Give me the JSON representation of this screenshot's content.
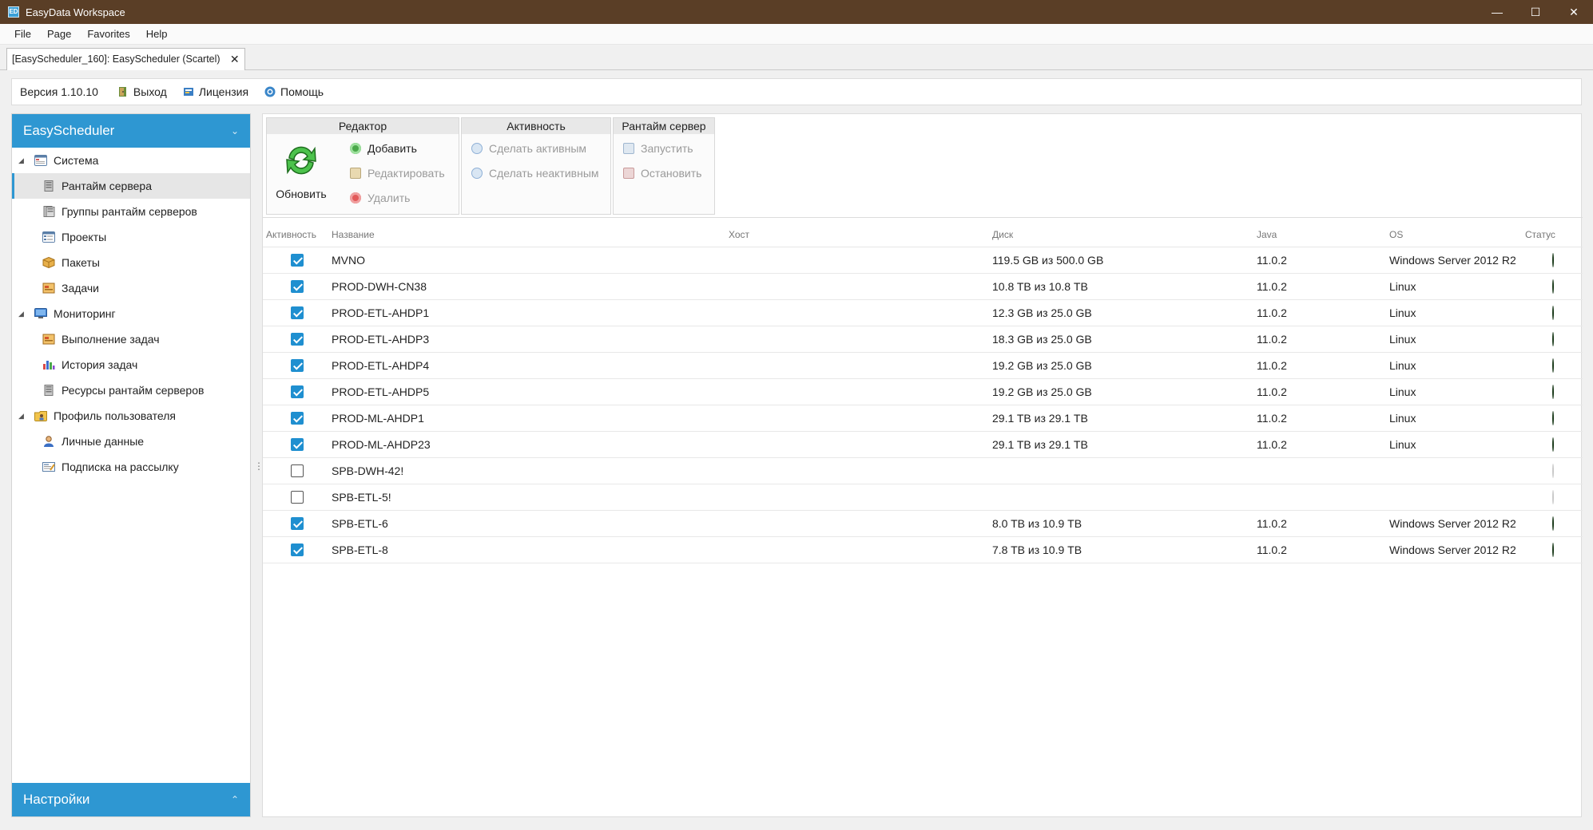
{
  "window": {
    "title": "EasyData Workspace",
    "icon_label": "ED",
    "controls": [
      "—",
      "☐",
      "✕"
    ]
  },
  "menu": [
    "File",
    "Page",
    "Favorites",
    "Help"
  ],
  "doc_tab": {
    "label": "[EasyScheduler_160]: EasyScheduler (Scartel)",
    "close": "✕"
  },
  "version_bar": {
    "version": "Версия 1.10.10",
    "exit": "Выход",
    "license": "Лицензия",
    "help": "Помощь"
  },
  "sidebar": {
    "header": "EasyScheduler",
    "footer": "Настройки",
    "items": [
      {
        "label": "Система",
        "icon": "window-icon"
      },
      {
        "label": "Рантайм сервера",
        "icon": "server-icon"
      },
      {
        "label": "Группы рантайм серверов",
        "icon": "server-group-icon"
      },
      {
        "label": "Проекты",
        "icon": "project-icon"
      },
      {
        "label": "Пакеты",
        "icon": "package-icon"
      },
      {
        "label": "Задачи",
        "icon": "task-icon"
      },
      {
        "label": "Мониторинг",
        "icon": "monitor-icon"
      },
      {
        "label": "Выполнение задач",
        "icon": "task-run-icon"
      },
      {
        "label": "История задач",
        "icon": "chart-icon"
      },
      {
        "label": "Ресурсы рантайм серверов",
        "icon": "server-resources-icon"
      },
      {
        "label": "Профиль пользователя",
        "icon": "profile-folder-icon"
      },
      {
        "label": "Личные данные",
        "icon": "user-icon"
      },
      {
        "label": "Подписка на рассылку",
        "icon": "subscription-icon"
      }
    ]
  },
  "ribbon": {
    "editor": {
      "title": "Редактор",
      "refresh": "Обновить",
      "add": "Добавить",
      "edit": "Редактировать",
      "delete": "Удалить"
    },
    "activity": {
      "title": "Активность",
      "make_active": "Сделать активным",
      "make_inactive": "Сделать неактивным"
    },
    "runtime": {
      "title": "Рантайм сервер",
      "start": "Запустить",
      "stop": "Остановить"
    }
  },
  "grid": {
    "headers": {
      "active": "Активность",
      "name": "Название",
      "host": "Хост",
      "disk": "Диск",
      "java": "Java",
      "os": "OS",
      "status": "Статус"
    },
    "rows": [
      {
        "active": true,
        "name": "MVNO",
        "host": "",
        "disk": "119.5 GB из 500.0 GB",
        "java": "11.0.2",
        "os": "Windows Server 2012 R2",
        "status": "online"
      },
      {
        "active": true,
        "name": "PROD-DWH-CN38",
        "host": "",
        "disk": "10.8 TB из 10.8 TB",
        "java": "11.0.2",
        "os": "Linux",
        "status": "online"
      },
      {
        "active": true,
        "name": "PROD-ETL-AHDP1",
        "host": "",
        "disk": "12.3 GB из 25.0 GB",
        "java": "11.0.2",
        "os": "Linux",
        "status": "online"
      },
      {
        "active": true,
        "name": "PROD-ETL-AHDP3",
        "host": "",
        "disk": "18.3 GB из 25.0 GB",
        "java": "11.0.2",
        "os": "Linux",
        "status": "online"
      },
      {
        "active": true,
        "name": "PROD-ETL-AHDP4",
        "host": "",
        "disk": "19.2 GB из 25.0 GB",
        "java": "11.0.2",
        "os": "Linux",
        "status": "online"
      },
      {
        "active": true,
        "name": "PROD-ETL-AHDP5",
        "host": "",
        "disk": "19.2 GB из 25.0 GB",
        "java": "11.0.2",
        "os": "Linux",
        "status": "online"
      },
      {
        "active": true,
        "name": "PROD-ML-AHDP1",
        "host": "",
        "disk": "29.1 TB из 29.1 TB",
        "java": "11.0.2",
        "os": "Linux",
        "status": "online"
      },
      {
        "active": true,
        "name": "PROD-ML-AHDP23",
        "host": "",
        "disk": "29.1 TB из 29.1 TB",
        "java": "11.0.2",
        "os": "Linux",
        "status": "online"
      },
      {
        "active": false,
        "name": "SPB-DWH-42!",
        "host": "",
        "disk": "",
        "java": "",
        "os": "",
        "status": "offline"
      },
      {
        "active": false,
        "name": "SPB-ETL-5!",
        "host": "",
        "disk": "",
        "java": "",
        "os": "",
        "status": "offline"
      },
      {
        "active": true,
        "name": "SPB-ETL-6",
        "host": "",
        "disk": "8.0 TB из 10.9 TB",
        "java": "11.0.2",
        "os": "Windows Server 2012 R2",
        "status": "online"
      },
      {
        "active": true,
        "name": "SPB-ETL-8",
        "host": "",
        "disk": "7.8 TB из 10.9 TB",
        "java": "11.0.2",
        "os": "Windows Server 2012 R2",
        "status": "online"
      }
    ]
  },
  "colors": {
    "titlebar": "#5a3e26",
    "accent": "#2e97d2",
    "status_online": "#1a9a1a",
    "status_offline": "#d0d0d0"
  }
}
